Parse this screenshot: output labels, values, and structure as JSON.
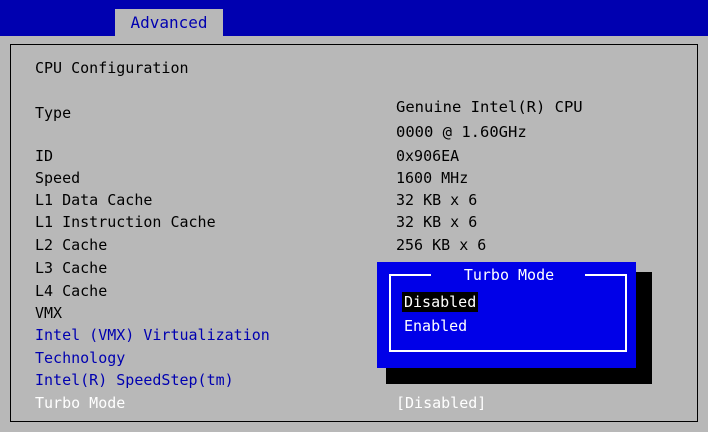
{
  "header": {
    "tab_label": "Advanced"
  },
  "section_title": "CPU Configuration",
  "rows": [
    {
      "label": "Type",
      "value_line1": "Genuine Intel(R) CPU",
      "value_line2": "0000 @ 1.60GHz"
    },
    {
      "label": "ID",
      "value": "0x906EA"
    },
    {
      "label": "Speed",
      "value": "1600 MHz"
    },
    {
      "label": "L1 Data Cache",
      "value": "32 KB x 6"
    },
    {
      "label": "L1 Instruction Cache",
      "value": "32 KB x 6"
    },
    {
      "label": "L2 Cache",
      "value": "256 KB x 6"
    },
    {
      "label": "L3 Cache"
    },
    {
      "label": "L4 Cache"
    },
    {
      "label": "VMX"
    },
    {
      "label_line1": "Intel (VMX) Virtualization",
      "label_line2": "Technology"
    },
    {
      "label": "Intel(R) SpeedStep(tm)"
    },
    {
      "label": "Turbo Mode",
      "value": "[Disabled]"
    }
  ],
  "popup": {
    "title": "Turbo Mode",
    "options": [
      "Disabled",
      "Enabled"
    ],
    "selected": "Disabled"
  },
  "colors": {
    "bios_blue": "#0000b0",
    "popup_blue": "#0000e8",
    "panel_gray": "#b8b8b8"
  }
}
